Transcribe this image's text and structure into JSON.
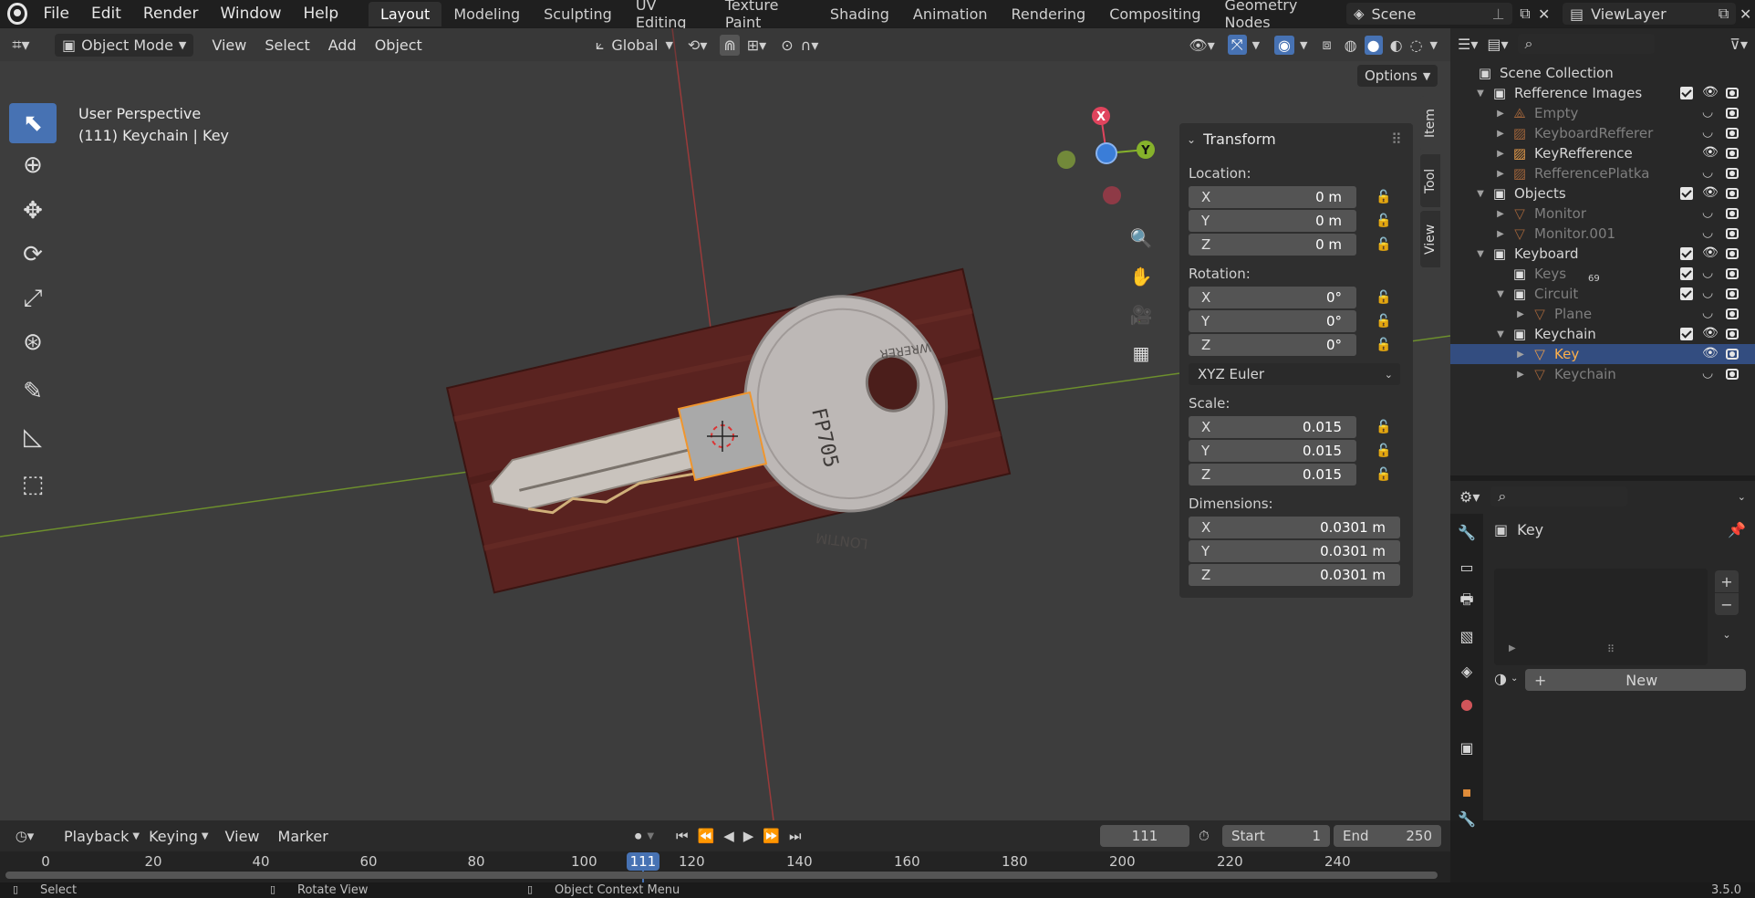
{
  "menu": [
    "File",
    "Edit",
    "Render",
    "Window",
    "Help"
  ],
  "workspaces": [
    "Layout",
    "Modeling",
    "Sculpting",
    "UV Editing",
    "Texture Paint",
    "Shading",
    "Animation",
    "Rendering",
    "Compositing",
    "Geometry Nodes"
  ],
  "scene": {
    "name": "Scene",
    "view_layer": "ViewLayer"
  },
  "viewport_header": {
    "mode": "Object Mode",
    "menus": [
      "View",
      "Select",
      "Add",
      "Object"
    ],
    "orientation": "Global",
    "options_label": "Options"
  },
  "viewport": {
    "perspective": "User Perspective",
    "context": "(111) Keychain | Key",
    "gizmo_axes": {
      "x": "X",
      "y": "Y"
    },
    "key_texts": {
      "a": "FP705",
      "b": "LONTIM",
      "c": "WRERER"
    }
  },
  "transform": {
    "title": "Transform",
    "location_label": "Location:",
    "location": [
      {
        "k": "X",
        "v": "0 m"
      },
      {
        "k": "Y",
        "v": "0 m"
      },
      {
        "k": "Z",
        "v": "0 m"
      }
    ],
    "rotation_label": "Rotation:",
    "rotation": [
      {
        "k": "X",
        "v": "0°"
      },
      {
        "k": "Y",
        "v": "0°"
      },
      {
        "k": "Z",
        "v": "0°"
      }
    ],
    "rotation_mode": "XYZ Euler",
    "scale_label": "Scale:",
    "scale": [
      {
        "k": "X",
        "v": "0.015"
      },
      {
        "k": "Y",
        "v": "0.015"
      },
      {
        "k": "Z",
        "v": "0.015"
      }
    ],
    "dimensions_label": "Dimensions:",
    "dimensions": [
      {
        "k": "X",
        "v": "0.0301 m"
      },
      {
        "k": "Y",
        "v": "0.0301 m"
      },
      {
        "k": "Z",
        "v": "0.0301 m"
      }
    ]
  },
  "side_tabs": [
    "Item",
    "Tool",
    "View"
  ],
  "outliner": {
    "root": "Scene Collection",
    "rows": [
      {
        "label": "Refference Images",
        "kind": "collection"
      },
      {
        "label": "Empty",
        "kind": "empty",
        "faded": true
      },
      {
        "label": "KeyboardRefferer",
        "kind": "image",
        "faded": true
      },
      {
        "label": "KeyRefference",
        "kind": "image"
      },
      {
        "label": "RefferencePlatka",
        "kind": "image",
        "faded": true
      },
      {
        "label": "Objects",
        "kind": "collection"
      },
      {
        "label": "Monitor",
        "kind": "mesh",
        "faded": true
      },
      {
        "label": "Monitor.001",
        "kind": "mesh",
        "faded": true
      },
      {
        "label": "Keyboard",
        "kind": "collection"
      },
      {
        "label": "Keys",
        "kind": "collection",
        "faded": true,
        "badge": "69"
      },
      {
        "label": "Circuit",
        "kind": "collection",
        "faded": true
      },
      {
        "label": "Plane",
        "kind": "mesh",
        "faded": true
      },
      {
        "label": "Keychain",
        "kind": "collection"
      },
      {
        "label": "Key",
        "kind": "mesh",
        "selected": true
      },
      {
        "label": "Keychain",
        "kind": "mesh",
        "faded": true
      }
    ]
  },
  "properties": {
    "object_name": "Key",
    "new_label": "New"
  },
  "timeline": {
    "menus": [
      "Playback",
      "Keying",
      "View",
      "Marker"
    ],
    "current_frame": "111",
    "start_label": "Start",
    "start": "1",
    "end_label": "End",
    "end": "250",
    "ruler": [
      "0",
      "20",
      "40",
      "60",
      "80",
      "100",
      "111",
      "120",
      "140",
      "160",
      "180",
      "200",
      "220",
      "240"
    ]
  },
  "status": {
    "left": "Select",
    "mid": "Rotate View",
    "right": "Object Context Menu",
    "version": "3.5.0"
  }
}
